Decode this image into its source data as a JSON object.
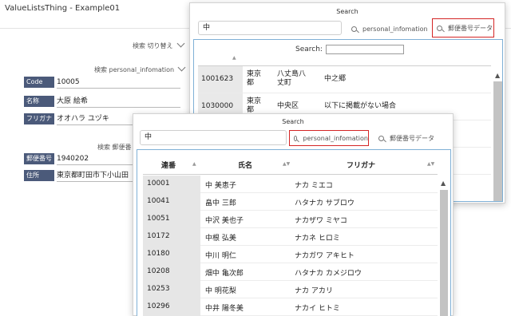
{
  "app": {
    "title": "ValueListsThing - Example01"
  },
  "base": {
    "toggle_label": "検索 切り替え",
    "section1_label": "検索 personal_infomation",
    "section2_label": "検索 郵便番",
    "fields1": [
      {
        "label": "Code",
        "value": "10005"
      },
      {
        "label": "名称",
        "value": "大原 絵希"
      },
      {
        "label": "フリガナ",
        "value": "オオハラ ユヅキ"
      }
    ],
    "fields2": [
      {
        "label": "郵便番号",
        "value": "1940202"
      },
      {
        "label": "住所",
        "value": "東京都町田市下小山田"
      }
    ]
  },
  "popup1": {
    "title": "Search",
    "search_value": "中",
    "toggle_personal": "personal_infomation",
    "toggle_postal": "郵便番号データ",
    "inner_search_label": "Search:",
    "inner_search_value": "",
    "rows": [
      {
        "code": "1001623",
        "pref": "東京都",
        "city": "八丈島八丈町",
        "area": "中之郷"
      },
      {
        "code": "1030000",
        "pref": "東京都",
        "city": "中央区",
        "area": "以下に掲載がない場合"
      }
    ]
  },
  "popup2": {
    "title": "Search",
    "search_value": "中",
    "toggle_personal": "personal_infomation",
    "toggle_postal": "郵便番号データ",
    "columns": [
      "連番",
      "氏名",
      "フリガナ"
    ],
    "rows": [
      {
        "id": "10001",
        "name": "中 美恵子",
        "kana": "ナカ ミエコ"
      },
      {
        "id": "10041",
        "name": "畠中 三郎",
        "kana": "ハタナカ サブロウ"
      },
      {
        "id": "10051",
        "name": "中沢 美也子",
        "kana": "ナカザワ ミヤコ"
      },
      {
        "id": "10172",
        "name": "中根 弘美",
        "kana": "ナカネ ヒロミ"
      },
      {
        "id": "10180",
        "name": "中川 明仁",
        "kana": "ナカガワ アキヒト"
      },
      {
        "id": "10208",
        "name": "畑中 亀次郎",
        "kana": "ハタナカ カメジロウ"
      },
      {
        "id": "10253",
        "name": "中 明花梨",
        "kana": "ナカ アカリ"
      },
      {
        "id": "10296",
        "name": "中井 陽冬美",
        "kana": "ナカイ ヒトミ"
      }
    ]
  }
}
